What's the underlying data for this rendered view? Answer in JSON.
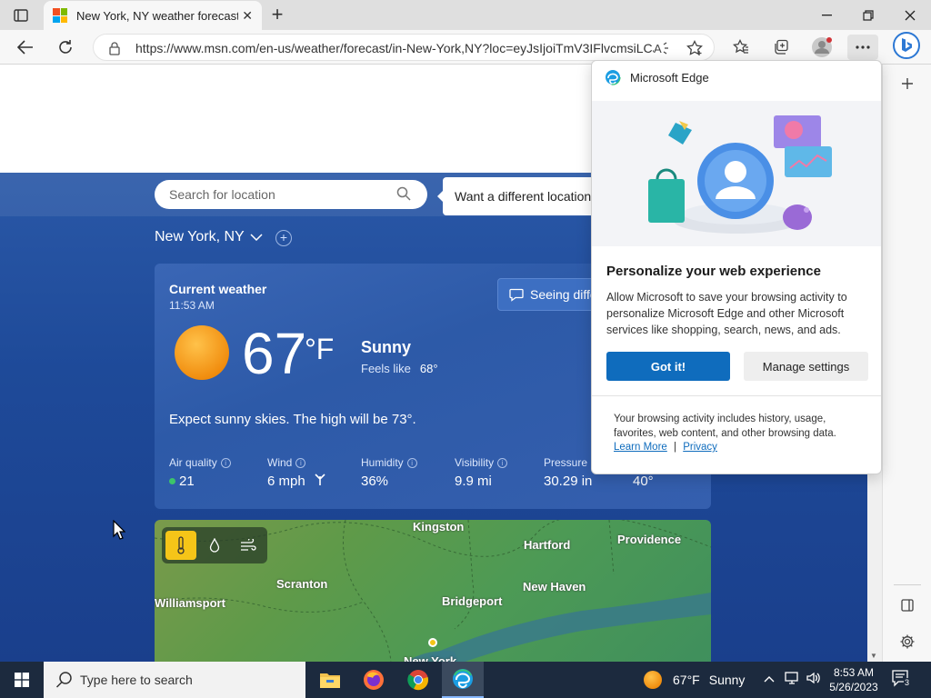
{
  "browser": {
    "tab": {
      "title": "New York, NY weather forecast | M"
    },
    "address": {
      "url": "https://www.msn.com/en-us/weather/forecast/in-New-York,NY?loc=eyJsIjoiTmV3IFlvcmsiLCJyIjoiTlkiLCJjIjoiVW5pdGVkIFN0YXRlcyJ9"
    }
  },
  "weather": {
    "search_placeholder": "Search for location",
    "different_location": "Want a different location?",
    "location": "New York, NY",
    "card": {
      "title": "Current weather",
      "time": "11:53 AM",
      "temp": "67",
      "unit": "°F",
      "condition": "Sunny",
      "feels_label": "Feels like",
      "feels_value": "68°",
      "seeing_btn": "Seeing different weather?",
      "expect": "Expect sunny skies. The high will be 73°.",
      "metrics": [
        {
          "label": "Air quality",
          "value": "21"
        },
        {
          "label": "Wind",
          "value": "6 mph"
        },
        {
          "label": "Humidity",
          "value": "36%"
        },
        {
          "label": "Visibility",
          "value": "9.9 mi"
        },
        {
          "label": "Pressure",
          "value": "30.29 in"
        },
        {
          "label": "",
          "value": "40°"
        }
      ]
    },
    "map": {
      "cities": [
        "Kingston",
        "Hartford",
        "Providence",
        "Scranton",
        "New Haven",
        "Williamsport",
        "Bridgeport",
        "New York"
      ]
    }
  },
  "popup": {
    "header": "Microsoft Edge",
    "title": "Personalize your web experience",
    "body": "Allow Microsoft to save your browsing activity to personalize Microsoft Edge and other Microsoft services like shopping, search, news, and ads.",
    "got_it": "Got it!",
    "manage": "Manage settings",
    "footer": "Your browsing activity includes history, usage, favorites, web content, and other browsing data.",
    "learn_more": "Learn More",
    "separator": "|",
    "privacy": "Privacy"
  },
  "taskbar": {
    "search_placeholder": "Type here to search",
    "weather_temp": "67°F",
    "weather_cond": "Sunny",
    "time": "8:53 AM",
    "date": "5/26/2023",
    "notif_count": "3"
  },
  "colors": {
    "accent": "#0f6cbd",
    "hero": "#1e4a99",
    "taskbar": "#1c2a3e",
    "aq_good": "#3cc46a"
  }
}
